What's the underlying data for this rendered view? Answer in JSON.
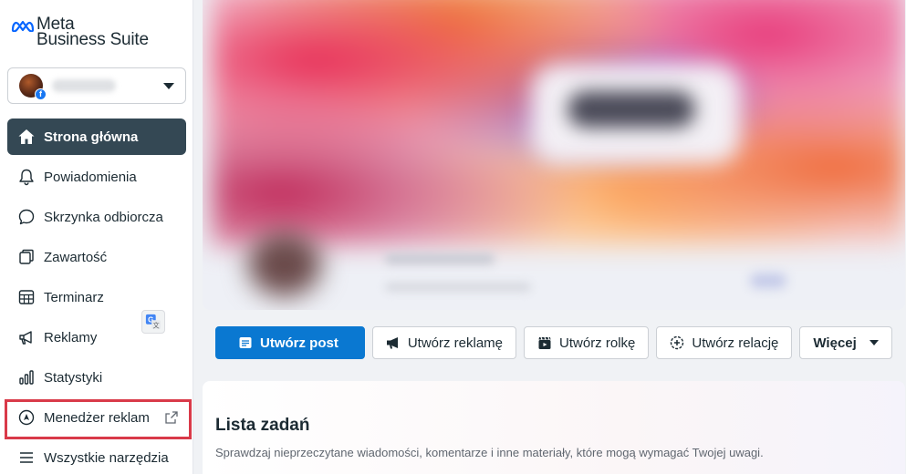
{
  "app": {
    "logo_line1": "Meta",
    "logo_line2": "Business Suite",
    "brand_color": "#0a78d1"
  },
  "account": {
    "name": "",
    "badge": "f"
  },
  "sidebar": {
    "items": [
      {
        "label": "Strona główna",
        "icon": "home-icon",
        "active": true
      },
      {
        "label": "Powiadomienia",
        "icon": "bell-icon"
      },
      {
        "label": "Skrzynka odbiorcza",
        "icon": "chat-bubble-icon"
      },
      {
        "label": "Zawartość",
        "icon": "content-icon"
      },
      {
        "label": "Terminarz",
        "icon": "calendar-grid-icon"
      },
      {
        "label": "Reklamy",
        "icon": "megaphone-icon"
      },
      {
        "label": "Statystyki",
        "icon": "bar-chart-icon"
      },
      {
        "label": "Menedżer reklam",
        "icon": "compass-icon",
        "external": true
      },
      {
        "label": "Wszystkie narzędzia",
        "icon": "menu-icon"
      }
    ]
  },
  "actions": {
    "create_post": "Utwórz post",
    "create_ad": "Utwórz reklamę",
    "create_reel": "Utwórz rolkę",
    "create_story": "Utwórz relację",
    "more": "Więcej"
  },
  "tasks": {
    "title": "Lista zadań",
    "description": "Sprawdzaj nieprzeczytane wiadomości, komentarze i inne materiały, które mogą wymagać Twojej uwagi."
  },
  "colors": {
    "active_nav_bg": "#344854",
    "highlight_border": "#d93a49"
  }
}
